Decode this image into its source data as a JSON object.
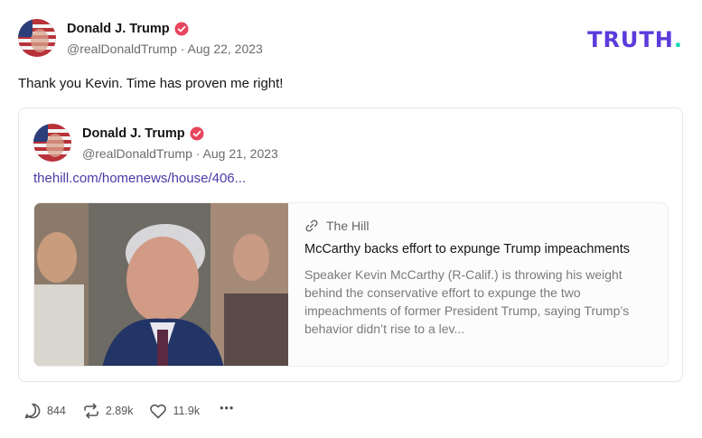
{
  "post": {
    "author": "Donald J. Trump",
    "handle": "@realDonaldTrump",
    "date": "Aug 22, 2023",
    "meta": "@realDonaldTrump · Aug 22, 2023",
    "text": "Thank you Kevin. Time has proven me right!"
  },
  "logo": {
    "text": "TRUTH",
    "dot": "."
  },
  "quoted": {
    "author": "Donald J. Trump",
    "meta": "@realDonaldTrump · Aug 21, 2023",
    "link": "thehill.com/homenews/house/406...",
    "card": {
      "source": "The Hill",
      "title": "McCarthy backs effort to expunge Trump impeachments",
      "description": "Speaker Kevin McCarthy (R-Calif.) is throwing his weight behind the conservative effort to expunge the two impeachments of former President Trump, saying Trump’s behavior didn’t rise to a lev..."
    }
  },
  "actions": {
    "replies": "844",
    "retruths": "2.89k",
    "likes": "11.9k"
  },
  "colors": {
    "brand": "#5b3bdc",
    "brand_dot": "#13d5b5",
    "verified": "#e8465c",
    "link": "#4a3aa6"
  }
}
